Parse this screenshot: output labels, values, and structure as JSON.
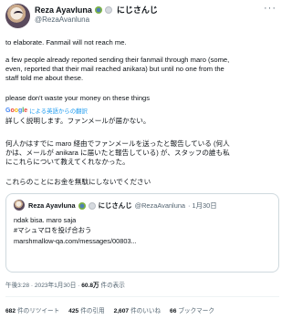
{
  "author": {
    "name": "Reza Ayavluna",
    "jp_name": "にじさんじ",
    "handle": "@RezaAvanluna"
  },
  "more_label": "···",
  "tweet": {
    "lines": [
      "to elaborate. Fanmail will not reach me.",
      "a few people already reported sending their fanmail through maro (some,",
      "even, reported that their mail reached anikara) but until no one from the",
      "staff told me about these.",
      "please don't waste your money on these things"
    ],
    "translate_brand": "Google",
    "translate_text": "による英語からの翻訳",
    "jp_lines": [
      "詳しく説明します。ファンメールが届かない。",
      "何人かはすでに maro 経由でファンメールを送ったと報告している (何人",
      "かは、メールが anikara に届いたと報告している) が、スタッフの誰も私",
      "にこれらについて教えてくれなかった。",
      "これらのことにお金を無駄にしないでください"
    ]
  },
  "quote": {
    "name": "Reza Ayavluna",
    "jp_name": "にじさんじ",
    "handle": "@RezaAvanluna",
    "date": "· 1月30日",
    "lines": [
      "ndak bisa. maro saja",
      "#マシュマロを投げ合おう",
      "marshmallow-qa.com/messages/00803..."
    ]
  },
  "meta": {
    "time": "午後3:28 · 2023年1月30日 · ",
    "views_count": "60.8万",
    "views_label": " 件の表示"
  },
  "stats": [
    {
      "count": "682",
      "label": "件のリツイート"
    },
    {
      "count": "425",
      "label": "件の引用"
    },
    {
      "count": "2,607",
      "label": "件のいいね"
    },
    {
      "count": "66",
      "label": "ブックマーク"
    }
  ]
}
